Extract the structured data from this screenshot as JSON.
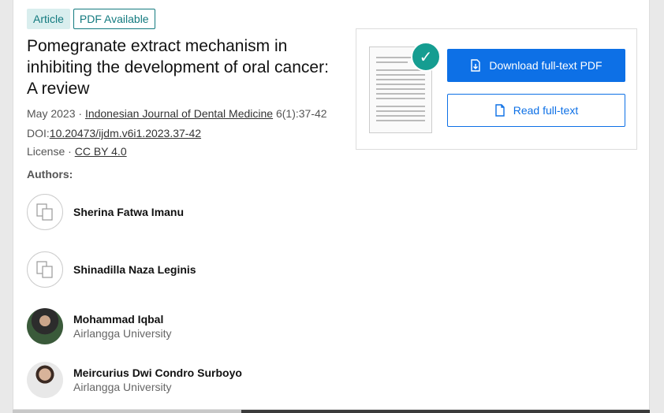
{
  "badges": {
    "article": "Article",
    "pdf": "PDF Available"
  },
  "title": "Pomegranate extract mechanism in inhibiting the development of oral cancer: A review",
  "meta": {
    "date": "May 2023",
    "sep": "·",
    "journal": "Indonesian Journal of Dental Medicine",
    "issue": "6(1):37-42",
    "doi_label": "DOI:",
    "doi": "10.20473/ijdm.v6i1.2023.37-42",
    "license_label": "License",
    "license": "CC BY 4.0"
  },
  "authors_heading": "Authors:",
  "authors": [
    {
      "name": "Sherina Fatwa Imanu",
      "affiliation": ""
    },
    {
      "name": "Shinadilla Naza Leginis",
      "affiliation": ""
    },
    {
      "name": "Mohammad Iqbal",
      "affiliation": "Airlangga University"
    },
    {
      "name": "Meircurius Dwi Condro Surboyo",
      "affiliation": "Airlangga University"
    }
  ],
  "actions": {
    "download": "Download full-text PDF",
    "read": "Read full-text"
  },
  "colors": {
    "accent": "#0d70e6",
    "teal": "#137a7f",
    "check": "#159d91"
  }
}
